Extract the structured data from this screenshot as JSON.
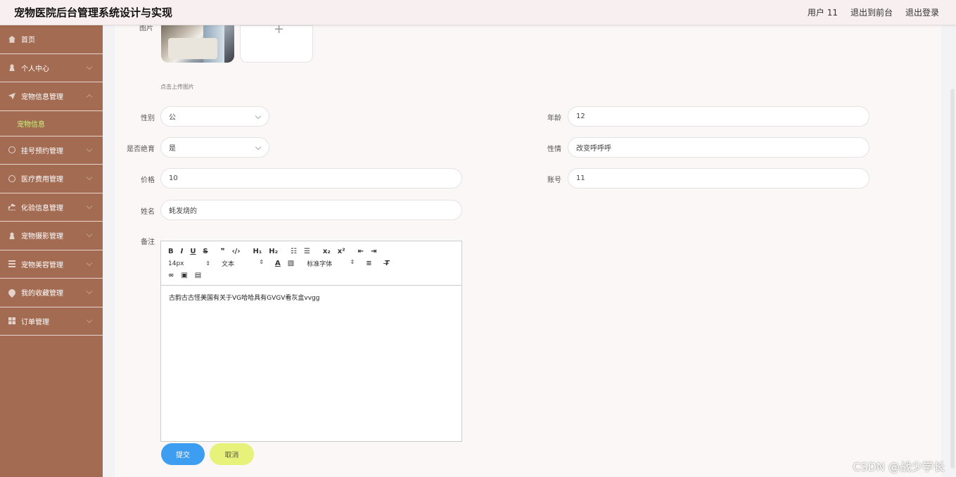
{
  "header": {
    "title": "宠物医院后台管理系统设计与实现",
    "user_label": "用户 11",
    "to_front_label": "退出到前台",
    "logout_label": "退出登录"
  },
  "sidebar": {
    "items": [
      {
        "label": "首页",
        "icon": "home-icon"
      },
      {
        "label": "个人中心",
        "icon": "user-icon"
      },
      {
        "label": "宠物信息管理",
        "icon": "send-icon",
        "expanded": true
      },
      {
        "label": "挂号预约管理",
        "icon": "clock-icon"
      },
      {
        "label": "医疗费用管理",
        "icon": "compass-icon"
      },
      {
        "label": "化验信息管理",
        "icon": "bank-icon"
      },
      {
        "label": "宠物摄影管理",
        "icon": "user-icon"
      },
      {
        "label": "宠物美容管理",
        "icon": "list-icon"
      },
      {
        "label": "我的收藏管理",
        "icon": "location-icon"
      },
      {
        "label": "订单管理",
        "icon": "grid-icon"
      }
    ],
    "sub_item": "宠物信息"
  },
  "form": {
    "image_label": "图片",
    "upload_hint": "点击上传图片",
    "gender_label": "性别",
    "gender_value": "公",
    "age_label": "年龄",
    "age_value": "12",
    "neutered_label": "是否绝育",
    "neutered_value": "是",
    "temper_label": "性情",
    "temper_value": "改变呼呼呼",
    "price_label": "价格",
    "price_value": "10",
    "account_label": "账号",
    "account_value": "11",
    "name_label": "姓名",
    "name_value": "蚝发烧的",
    "remark_label": "备注",
    "remark_content": "古韵古古怪美国有关于VG哈哈具有GVGV看灰盒vvgg"
  },
  "editor": {
    "size_select": "14px",
    "text_select": "文本",
    "font_select": "标准字体"
  },
  "buttons": {
    "submit": "提交",
    "cancel": "取消"
  },
  "watermark": "CSDN @战少学长",
  "colors": {
    "sidebar_bg": "#a36b52",
    "active_sub": "#c8f07a",
    "submit": "#3c9df1",
    "cancel": "#e7f27a"
  }
}
